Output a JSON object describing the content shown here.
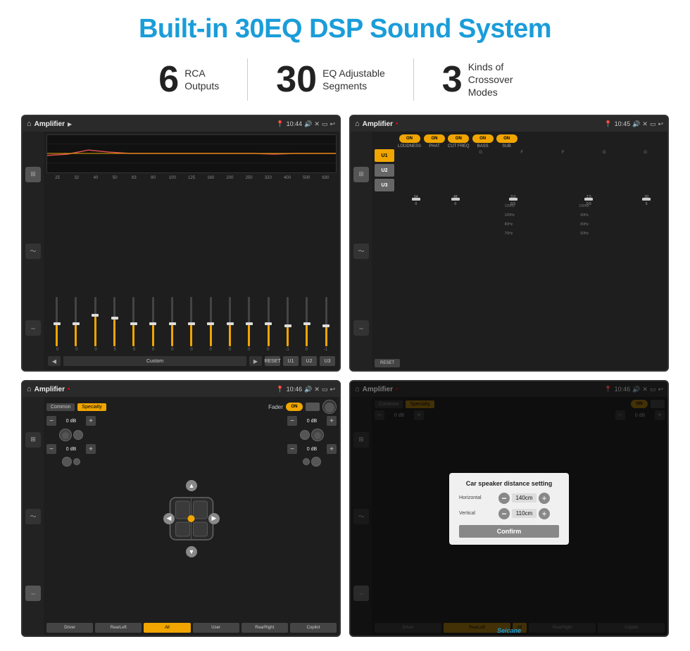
{
  "header": {
    "title": "Built-in 30EQ DSP Sound System"
  },
  "stats": [
    {
      "number": "6",
      "label": "RCA\nOutputs"
    },
    {
      "number": "30",
      "label": "EQ Adjustable\nSegments"
    },
    {
      "number": "3",
      "label": "Kinds of\nCrossover Modes"
    }
  ],
  "screens": {
    "screen1": {
      "title": "Amplifier",
      "time": "10:44",
      "freq_labels": [
        "25",
        "32",
        "40",
        "50",
        "63",
        "80",
        "100",
        "125",
        "160",
        "200",
        "250",
        "320",
        "400",
        "500",
        "630"
      ],
      "val_labels": [
        "0",
        "0",
        "0",
        "5",
        "0",
        "0",
        "0",
        "0",
        "0",
        "0",
        "0",
        "0",
        "-1",
        "0",
        "-1"
      ],
      "preset": "Custom",
      "buttons": [
        "RESET",
        "U1",
        "U2",
        "U3"
      ]
    },
    "screen2": {
      "title": "Amplifier",
      "time": "10:45",
      "u_buttons": [
        "U1",
        "U2",
        "U3"
      ],
      "toggles": [
        "LOUDNESS",
        "PHAT",
        "CUT FREQ",
        "BASS",
        "SUB"
      ],
      "reset_label": "RESET"
    },
    "screen3": {
      "title": "Amplifier",
      "time": "10:46",
      "tabs": [
        "Common",
        "Specialty"
      ],
      "fader_label": "Fader",
      "on_label": "ON",
      "db_values": [
        "0 dB",
        "0 dB",
        "0 dB",
        "0 dB"
      ],
      "buttons": [
        "Driver",
        "RearLeft",
        "All",
        "User",
        "RearRight",
        "Copilot"
      ]
    },
    "screen4": {
      "title": "Amplifier",
      "time": "10:46",
      "tabs": [
        "Common",
        "Specialty"
      ],
      "dialog": {
        "title": "Car speaker distance setting",
        "horizontal_label": "Horizontal",
        "horizontal_value": "140cm",
        "vertical_label": "Vertical",
        "vertical_value": "110cm",
        "confirm_label": "Confirm"
      },
      "buttons": [
        "Driver",
        "RearLeft",
        "All",
        "RearRight",
        "Copilot"
      ]
    }
  },
  "watermark": "Seicane"
}
